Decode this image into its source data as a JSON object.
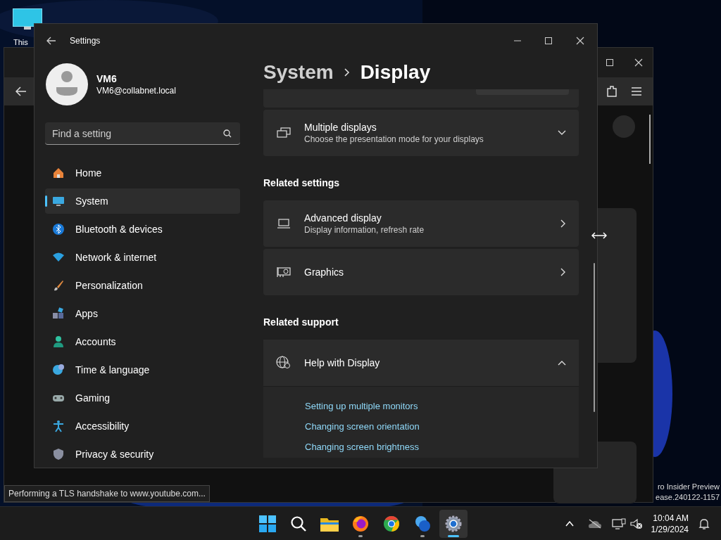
{
  "desktop": {
    "icon_label": "This",
    "watermark": [
      "ro Insider Preview",
      "ease.240122-1157"
    ]
  },
  "browser": {
    "status_text": "Performing a TLS handshake to www.youtube.com..."
  },
  "settings": {
    "title": "Settings",
    "user": {
      "name": "VM6",
      "email": "VM6@collabnet.local"
    },
    "search": {
      "placeholder": "Find a setting"
    },
    "nav": [
      {
        "kind": "home",
        "label": "Home",
        "selected": false
      },
      {
        "kind": "system",
        "label": "System",
        "selected": true
      },
      {
        "kind": "bluetooth",
        "label": "Bluetooth & devices",
        "selected": false
      },
      {
        "kind": "network",
        "label": "Network & internet",
        "selected": false
      },
      {
        "kind": "brush",
        "label": "Personalization",
        "selected": false
      },
      {
        "kind": "apps",
        "label": "Apps",
        "selected": false
      },
      {
        "kind": "accounts",
        "label": "Accounts",
        "selected": false
      },
      {
        "kind": "time",
        "label": "Time & language",
        "selected": false
      },
      {
        "kind": "gaming",
        "label": "Gaming",
        "selected": false
      },
      {
        "kind": "accessibility",
        "label": "Accessibility",
        "selected": false
      },
      {
        "kind": "privacy",
        "label": "Privacy & security",
        "selected": false
      }
    ],
    "breadcrumb": [
      "System",
      "Display"
    ],
    "content": [
      {
        "kind": "card",
        "title": "Multiple displays",
        "subtitle": "Choose the presentation mode for your displays",
        "expanded": false
      },
      {
        "kind": "heading",
        "title": "Related settings"
      },
      {
        "kind": "card",
        "title": "Advanced display",
        "subtitle": "Display information, refresh rate"
      },
      {
        "kind": "card",
        "title": "Graphics"
      },
      {
        "kind": "heading",
        "title": "Related support"
      },
      {
        "kind": "card",
        "title": "Help with Display",
        "expanded": true,
        "links": [
          "Setting up multiple monitors",
          "Changing screen orientation",
          "Changing screen brightness"
        ]
      }
    ]
  },
  "taskbar": {
    "apps": [
      {
        "kind": "start",
        "selected": false
      },
      {
        "kind": "search",
        "selected": false
      },
      {
        "kind": "explorer",
        "selected": false
      },
      {
        "kind": "firefox",
        "selected": false,
        "running": true
      },
      {
        "kind": "chrome",
        "selected": false
      },
      {
        "kind": "help",
        "selected": false,
        "running": true
      },
      {
        "kind": "settings",
        "selected": true,
        "running": true
      }
    ],
    "time": "10:04 AM",
    "date": "1/29/2024"
  }
}
